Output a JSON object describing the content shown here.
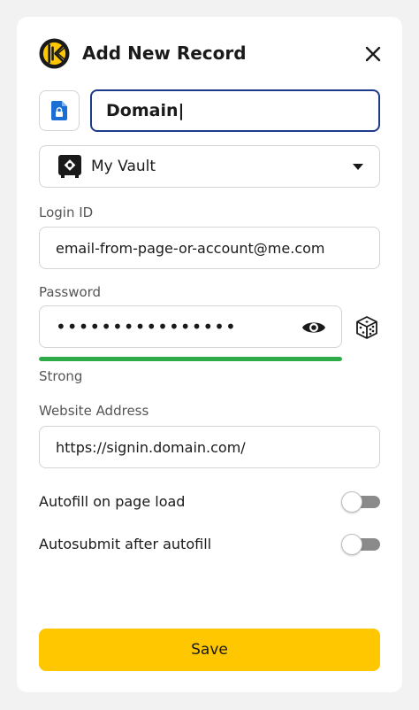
{
  "header": {
    "title": "Add New Record",
    "logo_icon": "keeper-logo-icon",
    "close_icon": "close-icon"
  },
  "record": {
    "type_icon": "file-lock-icon",
    "title_value": "Domain|"
  },
  "vault": {
    "icon": "vault-safe-icon",
    "selected": "My Vault"
  },
  "login": {
    "label": "Login ID",
    "value": "email-from-page-or-account@me.com"
  },
  "password": {
    "label": "Password",
    "masked_value": "••••••••••••••••",
    "strength": "Strong",
    "strength_fraction": 1.0,
    "strength_color": "#2eaa48"
  },
  "website": {
    "label": "Website Address",
    "value": "https://signin.domain.com/"
  },
  "toggles": {
    "autofill_label": "Autofill on page load",
    "autofill_on": false,
    "autosubmit_label": "Autosubmit after autofill",
    "autosubmit_on": false
  },
  "actions": {
    "save_label": "Save"
  },
  "colors": {
    "accent": "#ffc700",
    "focus_border": "#1e3a8a",
    "type_icon": "#1a6fd6"
  }
}
